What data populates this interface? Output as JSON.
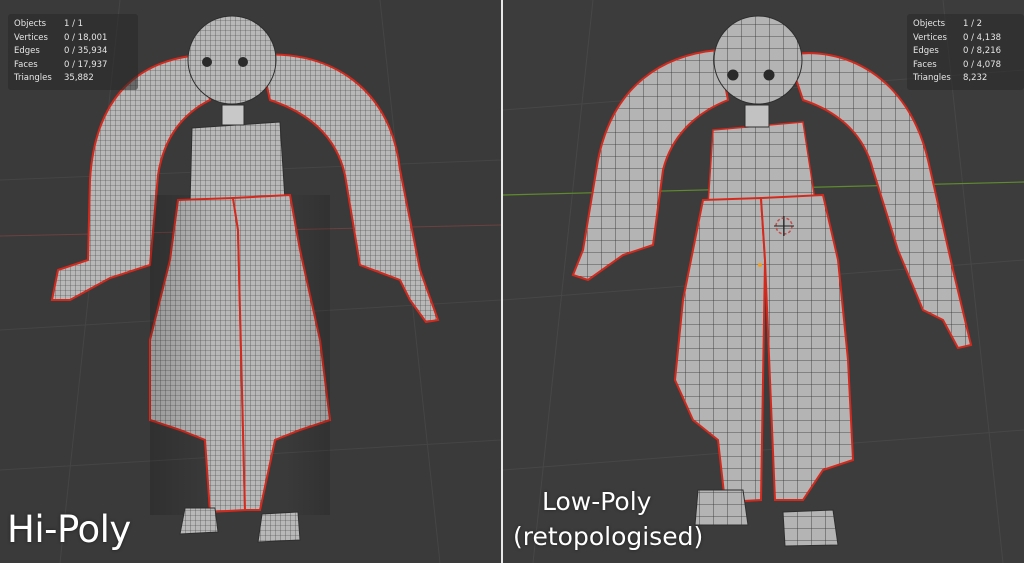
{
  "left_viewport": {
    "stats": [
      {
        "label": "Objects",
        "value": "1 / 1"
      },
      {
        "label": "Vertices",
        "value": "0 / 18,001"
      },
      {
        "label": "Edges",
        "value": "0 / 35,934"
      },
      {
        "label": "Faces",
        "value": "0 / 17,937"
      },
      {
        "label": "Triangles",
        "value": "35,882"
      }
    ],
    "caption": "Hi-Poly"
  },
  "right_viewport": {
    "stats": [
      {
        "label": "Objects",
        "value": "1 / 2"
      },
      {
        "label": "Vertices",
        "value": "0 / 4,138"
      },
      {
        "label": "Edges",
        "value": "0 / 8,216"
      },
      {
        "label": "Faces",
        "value": "0 / 4,078"
      },
      {
        "label": "Triangles",
        "value": "8,232"
      }
    ],
    "caption_line1": "Low-Poly",
    "caption_line2": "(retopologised)"
  },
  "colors": {
    "viewport_bg": "#3a3a3a",
    "mesh_fill": "#b4b4b4",
    "wire": "#2e2e2e",
    "seam": "#d42a1e",
    "grid": "#4a4a4a",
    "x_axis": "#7a3a3a",
    "y_axis": "#5f8a2e",
    "cursor": "#c0504d"
  }
}
